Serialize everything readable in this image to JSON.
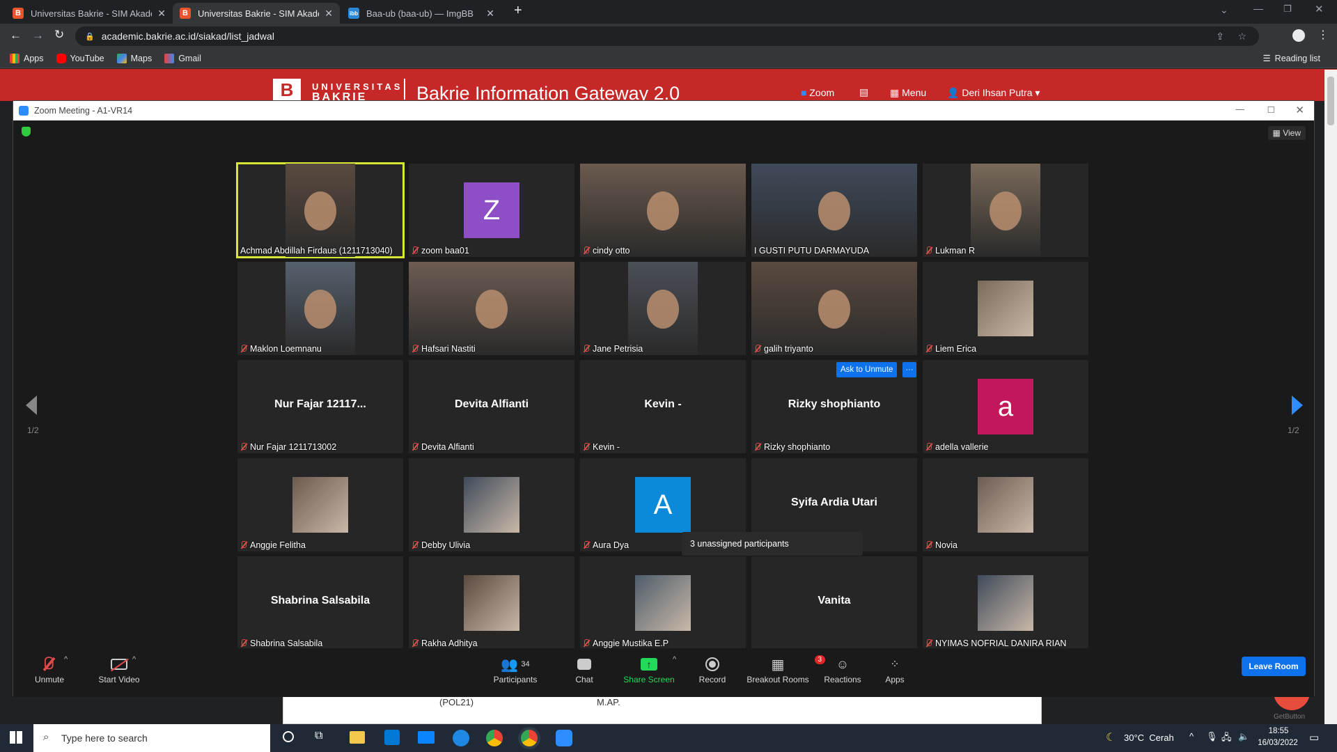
{
  "browser": {
    "tabs": [
      {
        "title": "Universitas Bakrie - SIM Akadem",
        "icon_text": "B",
        "active": false
      },
      {
        "title": "Universitas Bakrie - SIM Akadem",
        "icon_text": "B",
        "active": true
      },
      {
        "title": "Baa-ub (baa-ub) — ImgBB",
        "icon_text": "ibb",
        "active": false
      }
    ],
    "url": "academic.bakrie.ac.id/siakad/list_jadwal",
    "bookmarks": [
      "Apps",
      "YouTube",
      "Maps",
      "Gmail"
    ],
    "reading_list": "Reading list"
  },
  "site": {
    "logo_top": "UNIVERSITAS",
    "logo_bottom": "BAKRIE",
    "title": "Bakrie Information Gateway 2.0",
    "nav_zoom": "Zoom",
    "nav_menu": "Menu",
    "user": "Deri Ihsan Putra"
  },
  "zoom": {
    "window_title": "Zoom Meeting - A1-VR14",
    "view_label": "View",
    "page_indicator": "1/2",
    "ask_unmute": "Ask to Unmute",
    "more": "···",
    "unassigned": "3 unassigned participants",
    "participants": [
      {
        "name": "Achmad Abdillah Firdaus (1211713040)",
        "kind": "video",
        "active": true,
        "muted": false
      },
      {
        "name": "zoom baa01",
        "kind": "avatar",
        "letter": "Z",
        "color": "#8e4ec6",
        "muted": true
      },
      {
        "name": "cindy otto",
        "kind": "video",
        "muted": true
      },
      {
        "name": "I GUSTI PUTU DARMAYUDA",
        "kind": "video",
        "muted": false
      },
      {
        "name": "Lukman R",
        "kind": "video",
        "muted": true
      },
      {
        "name": "Maklon Loemnanu",
        "kind": "video",
        "muted": true
      },
      {
        "name": "Hafsari Nastiti",
        "kind": "video",
        "muted": true
      },
      {
        "name": "Jane Petrisia",
        "kind": "video",
        "muted": true
      },
      {
        "name": "galih triyanto",
        "kind": "video",
        "muted": true
      },
      {
        "name": "Liem Erica",
        "kind": "photo",
        "muted": true
      },
      {
        "name": "Nur Fajar 1211713002",
        "display": "Nur Fajar 12117...",
        "kind": "name",
        "muted": true
      },
      {
        "name": "Devita Alfianti",
        "display": "Devita Alfianti",
        "kind": "name",
        "muted": true
      },
      {
        "name": "Kevin -",
        "display": "Kevin -",
        "kind": "name",
        "muted": true
      },
      {
        "name": "Rizky shophianto",
        "display": "Rizky shophianto",
        "kind": "name",
        "muted": true
      },
      {
        "name": "adella vallerie",
        "kind": "avatar",
        "letter": "a",
        "color": "#c2185b",
        "muted": true
      },
      {
        "name": "Anggie Felitha",
        "kind": "photo",
        "muted": true
      },
      {
        "name": "Debby Ulivia",
        "kind": "photo",
        "muted": true
      },
      {
        "name": "Aura Dya",
        "kind": "avatar",
        "letter": "A",
        "color": "#0b8ad9",
        "muted": true
      },
      {
        "name": "Syifa Ardia Utari",
        "display": "Syifa Ardia Utari",
        "kind": "name",
        "muted": true
      },
      {
        "name": "Novia",
        "kind": "photo",
        "muted": true
      },
      {
        "name": "Shabrina Salsabila",
        "display": "Shabrina Salsabila",
        "kind": "name",
        "muted": true
      },
      {
        "name": "Rakha Adhitya",
        "kind": "photo",
        "muted": true
      },
      {
        "name": "Anggie Mustika E.P",
        "kind": "photo",
        "muted": true
      },
      {
        "name": "",
        "display": "Vanita",
        "kind": "name",
        "muted": false
      },
      {
        "name": "NYIMAS NOFRIAL DANIRA RIAN",
        "kind": "photo",
        "muted": true
      }
    ],
    "toolbar": {
      "unmute": "Unmute",
      "start_video": "Start Video",
      "participants": "Participants",
      "participants_count": "34",
      "chat": "Chat",
      "share_screen": "Share Screen",
      "record": "Record",
      "breakout": "Breakout Rooms",
      "breakout_badge": "3",
      "reactions": "Reactions",
      "apps": "Apps",
      "leave": "Leave Room"
    }
  },
  "background_page": {
    "cell1": "(POL21)",
    "cell2": "M.AP.",
    "get_button": "GetButton"
  },
  "taskbar": {
    "search_placeholder": "Type here to search",
    "weather": "30°C  Cerah",
    "time": "18:55",
    "date": "16/03/2022"
  },
  "colors": {
    "zoom_blue": "#0e72ed",
    "site_red": "#c62828",
    "active_speaker": "#d8e634",
    "share_green": "#23d959"
  }
}
